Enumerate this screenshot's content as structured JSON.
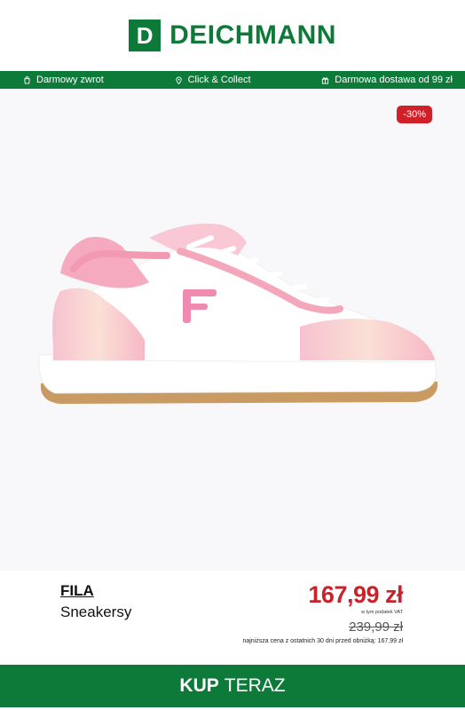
{
  "header": {
    "logo_mark": "D",
    "logo_text": "DEICHMANN"
  },
  "promo_bar": {
    "items": [
      {
        "icon": "return-bag-icon",
        "label": "Darmowy zwrot"
      },
      {
        "icon": "location-pin-icon",
        "label": "Click & Collect"
      },
      {
        "icon": "gift-box-icon",
        "label": "Darmowa dostawa od 99 zł"
      }
    ]
  },
  "product": {
    "discount": "-30%",
    "brand": "FILA",
    "name": "Sneakersy",
    "price": "167,99 zł",
    "vat_note": "w tym podatek VAT",
    "old_price": "239,99 zł",
    "lowest_price_note": "najniższa cena z ostatnich 30 dni przed obniżką: 167,99 zł"
  },
  "cta": {
    "strong": "KUP",
    "rest": "TERAZ"
  },
  "colors": {
    "brand_green": "#0e7a3a",
    "sale_red": "#c9222b"
  }
}
